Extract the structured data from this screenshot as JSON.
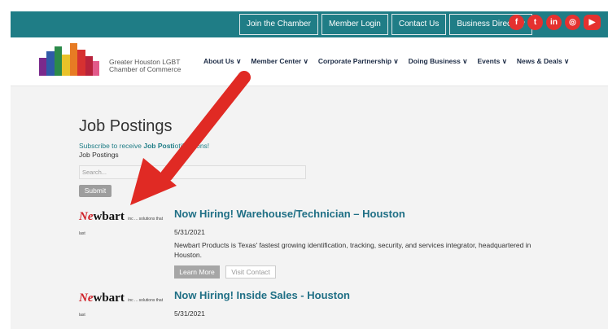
{
  "topbar": {
    "links": [
      "Join the Chamber",
      "Member Login",
      "Contact Us",
      "Business Directory"
    ],
    "social": [
      {
        "icon": "facebook-icon",
        "glyph": "f"
      },
      {
        "icon": "twitter-icon",
        "glyph": "t"
      },
      {
        "icon": "linkedin-icon",
        "glyph": "in"
      },
      {
        "icon": "instagram-icon",
        "glyph": "◎"
      },
      {
        "icon": "youtube-icon",
        "glyph": "▶"
      }
    ]
  },
  "header": {
    "org_line1": "Greater Houston LGBT",
    "org_line2": "Chamber of Commerce",
    "nav": [
      "About Us ∨",
      "Member Center ∨",
      "Corporate Partnership ∨",
      "Doing Business ∨",
      "Events ∨",
      "News & Deals ∨"
    ]
  },
  "main": {
    "title": "Job Postings",
    "subscribe_prefix": "Subscribe to receive ",
    "subscribe_link": "Job Posti",
    "subscribe_suffix": "otifications!",
    "breadcrumb": "Job Postings",
    "search_placeholder": "Search...",
    "submit_label": "Submit"
  },
  "jobs": [
    {
      "logo_n": "Ne",
      "logo_b": "wbart",
      "logo_small": "inc ... solutions that last",
      "title": "Now Hiring! Warehouse/Technician – Houston",
      "date": "5/31/2021",
      "description": "Newbart Products is Texas' fastest growing identification, tracking, security, and services integrator, headquartered in Houston.",
      "learn_more": "Learn More",
      "visit_contact": "Visit Contact"
    },
    {
      "logo_n": "Ne",
      "logo_b": "wbart",
      "logo_small": "inc ... solutions that last",
      "title": "Now Hiring! Inside Sales - Houston",
      "date": "5/31/2021"
    }
  ],
  "colors": {
    "teal": "#1f7d86",
    "social_red": "#e5312f",
    "arrow_red": "#e02a24",
    "job_title": "#1f6f85"
  }
}
